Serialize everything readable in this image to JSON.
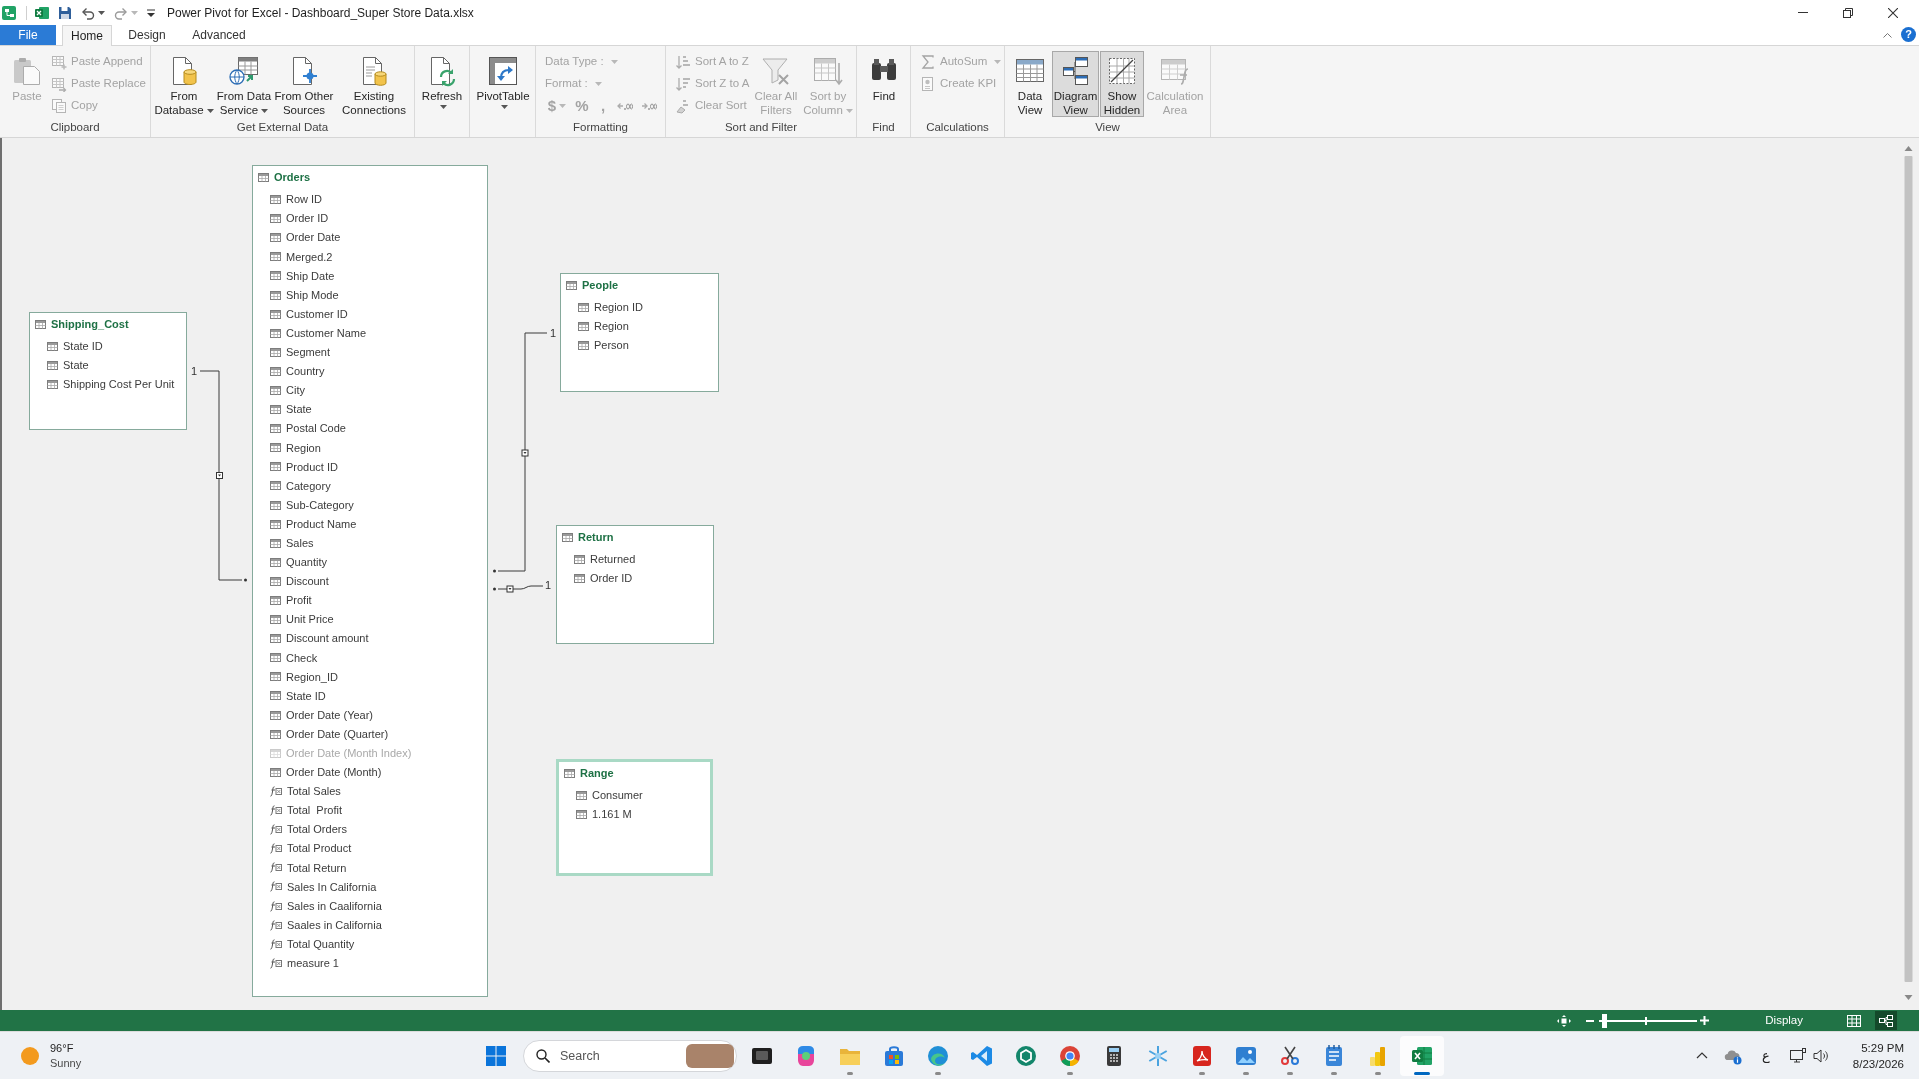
{
  "window": {
    "title": "Power Pivot for Excel - Dashboard_Super Store Data.xlsx"
  },
  "ribbon": {
    "tabs": [
      {
        "label": "File",
        "kind": "backstage",
        "selected": false
      },
      {
        "label": "Home",
        "kind": "tab",
        "selected": true
      },
      {
        "label": "Design",
        "kind": "tab",
        "selected": false
      },
      {
        "label": "Advanced",
        "kind": "tab",
        "selected": false
      }
    ],
    "help": {
      "label": "?"
    },
    "groups": [
      {
        "label": "Clipboard",
        "items": [
          {
            "kind": "large",
            "label": "Paste",
            "disabled": true,
            "dropdown": false
          },
          {
            "kind": "small",
            "label": "Paste Append",
            "disabled": true,
            "dropdown": false
          },
          {
            "kind": "small",
            "label": "Paste Replace",
            "disabled": true,
            "dropdown": false
          },
          {
            "kind": "small",
            "label": "Copy",
            "disabled": true,
            "dropdown": false
          }
        ]
      },
      {
        "label": "Get External Data",
        "items": [
          {
            "kind": "large",
            "label": "From Database",
            "disabled": false,
            "dropdown": true
          },
          {
            "kind": "large",
            "label": "From Data Service",
            "disabled": false,
            "dropdown": true
          },
          {
            "kind": "large",
            "label": "From Other Sources",
            "disabled": false,
            "dropdown": false
          },
          {
            "kind": "large",
            "label": "Existing Connections",
            "disabled": false,
            "dropdown": false
          }
        ]
      },
      {
        "items": [
          {
            "kind": "split",
            "label": "Refresh",
            "disabled": false,
            "dropdown": true
          }
        ]
      },
      {
        "items": [
          {
            "kind": "split",
            "label": "PivotTable",
            "disabled": false,
            "dropdown": true
          }
        ]
      },
      {
        "label": "Formatting",
        "items": [
          {
            "kind": "combo",
            "label": "Data Type :",
            "disabled": true,
            "dropdown": true
          },
          {
            "kind": "combo",
            "label": "Format :",
            "disabled": true,
            "dropdown": true
          },
          {
            "kind": "glyph",
            "label": "$",
            "disabled": true,
            "dropdown": true
          },
          {
            "kind": "glyph",
            "label": "%",
            "disabled": true,
            "dropdown": false
          },
          {
            "kind": "glyph",
            "label": ",",
            "disabled": true,
            "dropdown": false
          },
          {
            "kind": "icon",
            "disabled": true,
            "dropdown": false
          },
          {
            "kind": "icon",
            "disabled": true,
            "dropdown": false
          }
        ]
      },
      {
        "label": "Sort and Filter",
        "items": [
          {
            "kind": "small",
            "label": "Sort A to Z",
            "disabled": true,
            "dropdown": false
          },
          {
            "kind": "small",
            "label": "Sort Z to A",
            "disabled": true,
            "dropdown": false
          },
          {
            "kind": "small",
            "label": "Clear Sort",
            "disabled": true,
            "dropdown": false
          },
          {
            "kind": "large",
            "label": "Clear All Filters",
            "disabled": true,
            "dropdown": false
          },
          {
            "kind": "large",
            "label": "Sort by Column",
            "disabled": true,
            "dropdown": true
          }
        ]
      },
      {
        "label": "Find",
        "items": [
          {
            "kind": "large",
            "label": "Find",
            "disabled": false,
            "dropdown": false
          }
        ]
      },
      {
        "label": "Calculations",
        "items": [
          {
            "kind": "small",
            "label": "AutoSum",
            "disabled": true,
            "dropdown": true
          },
          {
            "kind": "small",
            "label": "Create KPI",
            "disabled": true,
            "dropdown": false
          }
        ]
      },
      {
        "label": "View",
        "items": [
          {
            "kind": "large",
            "label": "Data View",
            "disabled": false,
            "dropdown": false,
            "selected": false
          },
          {
            "kind": "large",
            "label": "Diagram View",
            "disabled": false,
            "dropdown": false,
            "selected": true
          },
          {
            "kind": "large",
            "label": "Show Hidden",
            "disabled": false,
            "dropdown": false,
            "selected": true
          },
          {
            "kind": "large",
            "label": "Calculation Area",
            "disabled": true,
            "dropdown": false,
            "selected": false
          }
        ]
      }
    ]
  },
  "diagram": {
    "tables": [
      {
        "name": "Shipping_Cost",
        "selected": false,
        "columns": [
          {
            "name": "State ID",
            "kind": "column",
            "hidden": false
          },
          {
            "name": "State",
            "kind": "column",
            "hidden": false
          },
          {
            "name": "Shipping Cost Per Unit",
            "kind": "column",
            "hidden": false
          }
        ]
      },
      {
        "name": "Orders",
        "selected": false,
        "columns": [
          {
            "name": "Row ID",
            "kind": "column",
            "hidden": false
          },
          {
            "name": "Order ID",
            "kind": "column",
            "hidden": false
          },
          {
            "name": "Order Date",
            "kind": "column",
            "hidden": false
          },
          {
            "name": "Merged.2",
            "kind": "column",
            "hidden": false
          },
          {
            "name": "Ship Date",
            "kind": "column",
            "hidden": false
          },
          {
            "name": "Ship Mode",
            "kind": "column",
            "hidden": false
          },
          {
            "name": "Customer ID",
            "kind": "column",
            "hidden": false
          },
          {
            "name": "Customer Name",
            "kind": "column",
            "hidden": false
          },
          {
            "name": "Segment",
            "kind": "column",
            "hidden": false
          },
          {
            "name": "Country",
            "kind": "column",
            "hidden": false
          },
          {
            "name": "City",
            "kind": "column",
            "hidden": false
          },
          {
            "name": "State",
            "kind": "column",
            "hidden": false
          },
          {
            "name": "Postal Code",
            "kind": "column",
            "hidden": false
          },
          {
            "name": "Region",
            "kind": "column",
            "hidden": false
          },
          {
            "name": "Product ID",
            "kind": "column",
            "hidden": false
          },
          {
            "name": "Category",
            "kind": "column",
            "hidden": false
          },
          {
            "name": "Sub-Category",
            "kind": "column",
            "hidden": false
          },
          {
            "name": "Product Name",
            "kind": "column",
            "hidden": false
          },
          {
            "name": "Sales",
            "kind": "column",
            "hidden": false
          },
          {
            "name": "Quantity",
            "kind": "column",
            "hidden": false
          },
          {
            "name": "Discount",
            "kind": "column",
            "hidden": false
          },
          {
            "name": "Profit",
            "kind": "column",
            "hidden": false
          },
          {
            "name": "Unit Price",
            "kind": "column",
            "hidden": false
          },
          {
            "name": "Discount amount",
            "kind": "column",
            "hidden": false
          },
          {
            "name": "Check",
            "kind": "column",
            "hidden": false
          },
          {
            "name": "Region_ID",
            "kind": "column",
            "hidden": false
          },
          {
            "name": "State ID",
            "kind": "column",
            "hidden": false
          },
          {
            "name": "Order Date (Year)",
            "kind": "column",
            "hidden": false
          },
          {
            "name": "Order Date (Quarter)",
            "kind": "column",
            "hidden": false
          },
          {
            "name": "Order Date (Month Index)",
            "kind": "column",
            "hidden": true
          },
          {
            "name": "Order Date (Month)",
            "kind": "column",
            "hidden": false
          },
          {
            "name": "Total Sales",
            "kind": "measure",
            "hidden": false
          },
          {
            "name": "Total  Profit",
            "kind": "measure",
            "hidden": false
          },
          {
            "name": "Total Orders",
            "kind": "measure",
            "hidden": false
          },
          {
            "name": "Total Product",
            "kind": "measure",
            "hidden": false
          },
          {
            "name": "Total Return",
            "kind": "measure",
            "hidden": false
          },
          {
            "name": "Sales In California",
            "kind": "measure",
            "hidden": false
          },
          {
            "name": "Sales in Caalifornia",
            "kind": "measure",
            "hidden": false
          },
          {
            "name": "Saales in California",
            "kind": "measure",
            "hidden": false
          },
          {
            "name": "Total Quantity",
            "kind": "measure",
            "hidden": false
          },
          {
            "name": "measure 1",
            "kind": "measure",
            "hidden": false
          }
        ]
      },
      {
        "name": "People",
        "selected": false,
        "columns": [
          {
            "name": "Region ID",
            "kind": "column",
            "hidden": false
          },
          {
            "name": "Region",
            "kind": "column",
            "hidden": false
          },
          {
            "name": "Person",
            "kind": "column",
            "hidden": false
          }
        ]
      },
      {
        "name": "Return",
        "selected": false,
        "columns": [
          {
            "name": "Returned",
            "kind": "column",
            "hidden": false
          },
          {
            "name": "Order ID",
            "kind": "column",
            "hidden": false
          }
        ]
      },
      {
        "name": "Range",
        "selected": true,
        "columns": [
          {
            "name": "Consumer",
            "kind": "column",
            "hidden": false
          },
          {
            "name": "1.161 M",
            "kind": "column",
            "hidden": false
          }
        ]
      }
    ],
    "relationships": [
      {
        "cardinality": "1"
      },
      {
        "cardinality": "1"
      },
      {
        "cardinality": "1"
      }
    ]
  },
  "status_bar": {
    "zoom": {
      "level": 0.05
    },
    "display_label": "Display",
    "views": [
      {
        "selected": false
      },
      {
        "selected": true
      }
    ]
  },
  "taskbar": {
    "weather": {
      "temperature": "96°F",
      "condition": "Sunny"
    },
    "search": {
      "placeholder": "Search"
    },
    "apps": [
      {
        "running": false,
        "selected": false
      },
      {
        "running": false,
        "selected": false
      },
      {
        "running": true,
        "selected": false
      },
      {
        "running": false,
        "selected": false
      },
      {
        "running": true,
        "selected": false
      },
      {
        "running": false,
        "selected": false
      },
      {
        "running": false,
        "selected": false
      },
      {
        "running": true,
        "selected": false
      },
      {
        "running": false,
        "selected": false
      },
      {
        "running": false,
        "selected": false
      },
      {
        "running": true,
        "selected": false
      },
      {
        "running": true,
        "selected": false
      },
      {
        "running": true,
        "selected": false
      },
      {
        "running": true,
        "selected": false
      },
      {
        "running": true,
        "selected": false
      },
      {
        "running": true,
        "selected": true
      }
    ],
    "tray": {
      "language": "ع",
      "time": "5:29 PM",
      "date": "8/23/2026"
    }
  }
}
